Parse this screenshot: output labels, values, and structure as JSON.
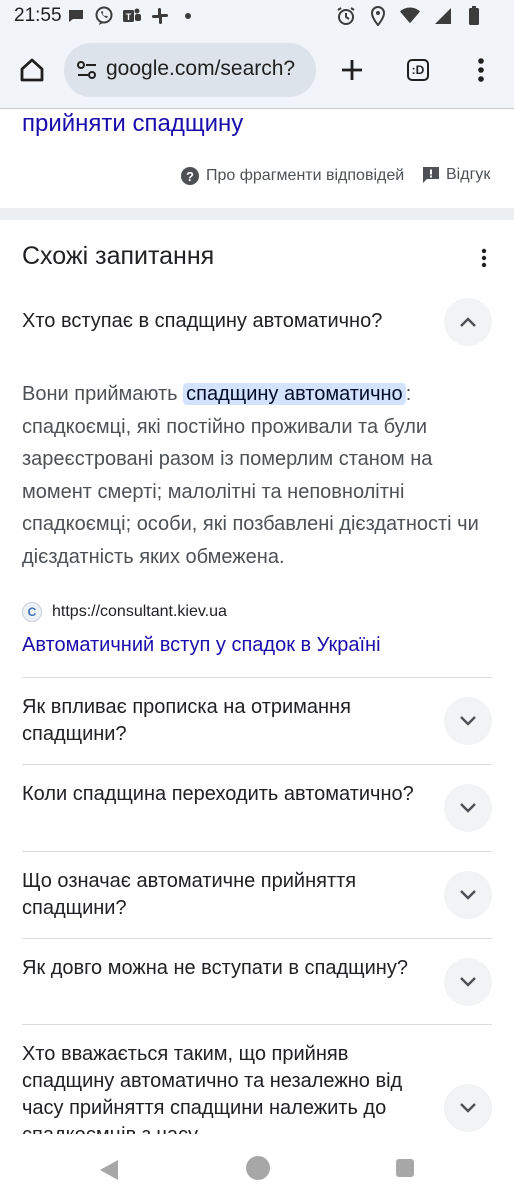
{
  "status_bar": {
    "time": "21:55",
    "left_icons": [
      "chat-bubble-icon",
      "viber-icon",
      "teams-icon",
      "slack-icon",
      "dot-icon"
    ],
    "right_icons": [
      "alarm-icon",
      "location-icon",
      "wifi-icon",
      "signal-icon",
      "battery-icon"
    ]
  },
  "browser": {
    "url": "google.com/search?",
    "tab_button_label": ":D"
  },
  "prev_result": {
    "link_text": "прийняти спадщину"
  },
  "snippet_footer": {
    "about_label": "Про фрагменти відповідей",
    "feedback_label": "Відгук"
  },
  "paa": {
    "title": "Схожі запитання",
    "expanded": {
      "question": "Хто вступає в спадщину автоматично?",
      "answer_before": "Вони приймають ",
      "answer_highlight": "спадщину автоматично",
      "answer_after": ": спадкоємці, які постійно проживали та були зареєстровані разом із померлим станом на момент смерті; малолітні та неповнолітні спадкоємці; особи, які позбавлені дієздатності чи дієздатність яких обмежена.",
      "source_url": "https://consultant.kiev.ua",
      "source_title": "Автоматичний вступ у спадок в Україні"
    },
    "questions": [
      "Як впливає прописка на отримання спадщини?",
      "Коли спадщина переходить автоматично?",
      "Що означає автоматичне прийняття спадщини?",
      "Як довго можна не вступати в спадщину?",
      "Хто вважається таким, що прийняв спадщину автоматично та незалежно від часу прийняття спадщини належить до спадкоємців з часу"
    ]
  },
  "colors": {
    "link": "#1a0dab",
    "highlight": "#d3e3fd",
    "chrome_bg": "#f1f4f9"
  }
}
